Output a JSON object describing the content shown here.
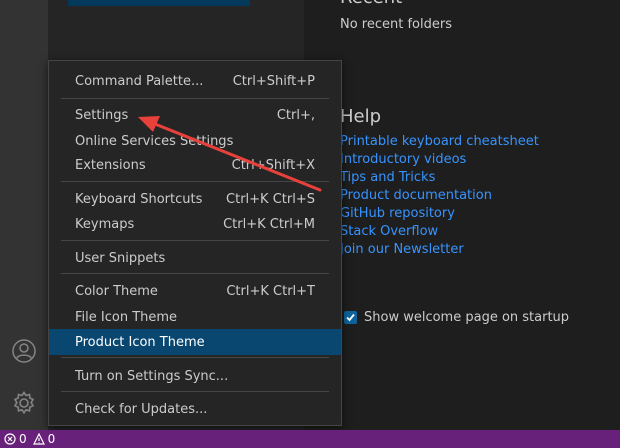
{
  "welcome": {
    "recent_title": "Recent",
    "recent_empty": "No recent folders",
    "help_title": "Help",
    "help_links": [
      "Printable keyboard cheatsheet",
      "Introductory videos",
      "Tips and Tricks",
      "Product documentation",
      "GitHub repository",
      "Stack Overflow",
      "Join our Newsletter"
    ],
    "show_welcome_label": "Show welcome page on startup"
  },
  "menu": {
    "items": [
      {
        "label": "Command Palette...",
        "shortcut": "Ctrl+Shift+P"
      },
      {
        "label": "Settings",
        "shortcut": "Ctrl+,"
      },
      {
        "label": "Online Services Settings",
        "shortcut": ""
      },
      {
        "label": "Extensions",
        "shortcut": "Ctrl+Shift+X"
      },
      {
        "label": "Keyboard Shortcuts",
        "shortcut": "Ctrl+K Ctrl+S"
      },
      {
        "label": "Keymaps",
        "shortcut": "Ctrl+K Ctrl+M"
      },
      {
        "label": "User Snippets",
        "shortcut": ""
      },
      {
        "label": "Color Theme",
        "shortcut": "Ctrl+K Ctrl+T"
      },
      {
        "label": "File Icon Theme",
        "shortcut": ""
      },
      {
        "label": "Product Icon Theme",
        "shortcut": ""
      },
      {
        "label": "Turn on Settings Sync...",
        "shortcut": ""
      },
      {
        "label": "Check for Updates...",
        "shortcut": ""
      }
    ],
    "active_item": "Product Icon Theme"
  },
  "status_bar": {
    "errors": "0",
    "warnings": "0",
    "background": "#68217a"
  },
  "icons": {
    "activity_bar": [
      "account-icon",
      "manage-gear-icon"
    ],
    "status_bar": [
      "error-icon",
      "warning-icon"
    ]
  },
  "colors": {
    "link": "#3794ff",
    "menu_active": "#094771",
    "annotation_arrow": "#e8413b"
  }
}
